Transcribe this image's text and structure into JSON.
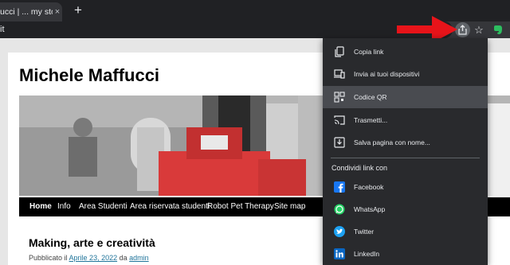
{
  "browser": {
    "tab_title": "ucci | ... my storie",
    "tab_close": "×",
    "new_tab": "+",
    "omnibox_text": "it",
    "star_glyph": "☆"
  },
  "page": {
    "site_title": "Michele Maffucci",
    "nav": [
      "Home",
      "Info",
      "Area Studenti",
      "Area riservata studenti",
      "Robot Pet Therapy",
      "Site map"
    ],
    "post_title": "Making, arte e creatività",
    "post_meta_prefix": "Pubblicato il",
    "post_date": "Aprile 23, 2022",
    "post_meta_by": "da",
    "post_author": "admin"
  },
  "share_menu": {
    "items": [
      {
        "label": "Copia link",
        "icon": "copy-icon"
      },
      {
        "label": "Invia ai tuoi dispositivi",
        "icon": "devices-icon"
      },
      {
        "label": "Codice QR",
        "icon": "qr-code-icon"
      },
      {
        "label": "Trasmetti...",
        "icon": "cast-icon"
      },
      {
        "label": "Salva pagina con nome...",
        "icon": "save-page-icon"
      }
    ],
    "section_title": "Condividi link con",
    "share_targets": [
      {
        "label": "Facebook",
        "icon": "facebook-icon"
      },
      {
        "label": "WhatsApp",
        "icon": "whatsapp-icon"
      },
      {
        "label": "Twitter",
        "icon": "twitter-icon"
      },
      {
        "label": "LinkedIn",
        "icon": "linkedin-icon"
      }
    ],
    "highlighted_item": "Codice QR"
  },
  "colors": {
    "arrow": "#e8141a",
    "menu_bg": "#292a2d",
    "menu_highlight": "#494b50",
    "nav_bg": "#000000",
    "link": "#21759b",
    "facebook": "#1877f2",
    "whatsapp": "#25d366",
    "twitter": "#1da1f2",
    "linkedin": "#0a66c2",
    "extension": "#2dbe60"
  }
}
